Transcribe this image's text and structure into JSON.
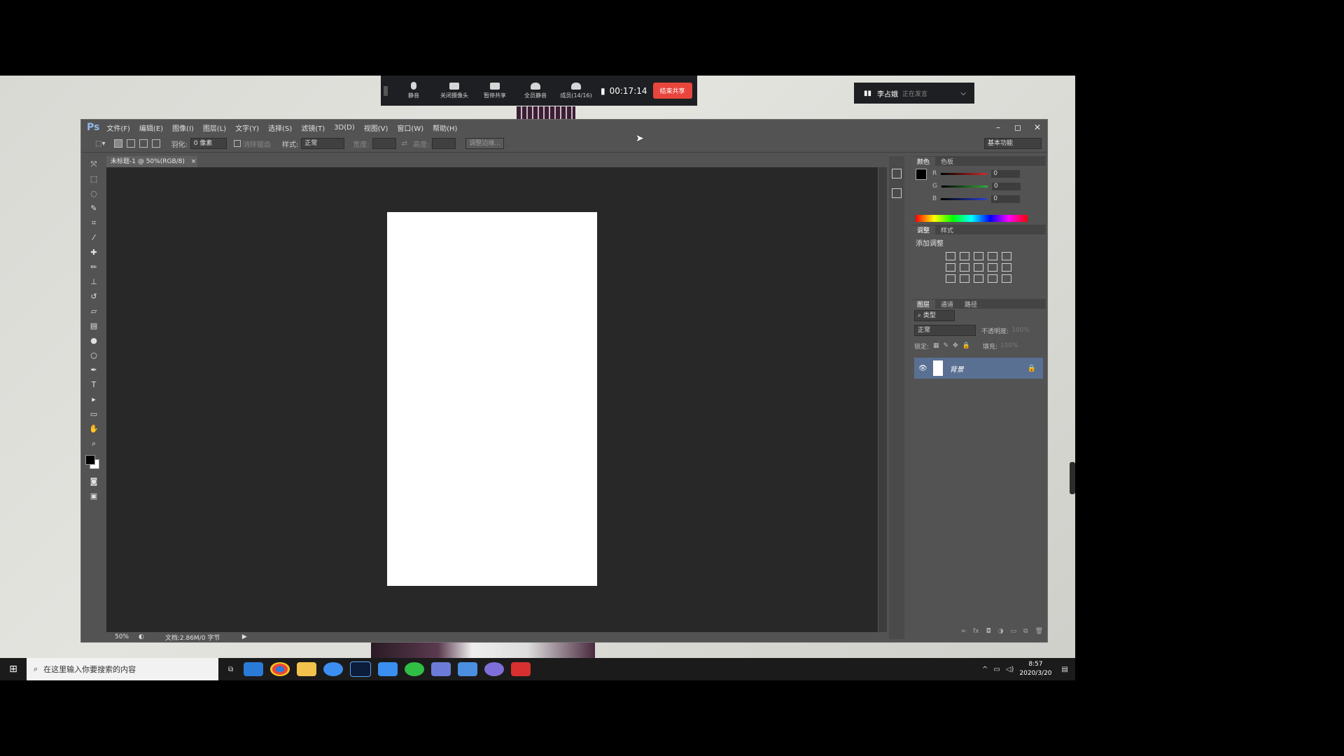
{
  "meeting": {
    "buttons": [
      {
        "label": "静音"
      },
      {
        "label": "关闭摄像头"
      },
      {
        "label": "暂停共享"
      },
      {
        "label": "全员静音"
      },
      {
        "label": "成员(14/16)"
      }
    ],
    "elapsed": "00:17:14",
    "end_label": "结束共享",
    "speaker_name": "李占娥",
    "speaker_status": "正在发言"
  },
  "ps": {
    "logo": "Ps",
    "menus": [
      "文件(F)",
      "编辑(E)",
      "图像(I)",
      "图层(L)",
      "文字(Y)",
      "选择(S)",
      "滤镜(T)",
      "3D(D)",
      "视图(V)",
      "窗口(W)",
      "帮助(H)"
    ],
    "options": {
      "feather_label": "羽化:",
      "feather_value": "0 像素",
      "antialias_label": "消除锯齿",
      "style_label": "样式:",
      "style_value": "正常",
      "width_label": "宽度:",
      "height_label": "高度:",
      "refine_edge": "调整边缘...",
      "workspace": "基本功能"
    },
    "doc_tab": "未标题-1 @ 50%(RGB/8)",
    "status": {
      "zoom": "50%",
      "doc_info": "文档:2.86M/0 字节"
    },
    "color_panel": {
      "tabs": [
        "颜色",
        "色板"
      ],
      "channels": [
        {
          "name": "R",
          "value": "0",
          "color": "#d22a2a"
        },
        {
          "name": "G",
          "value": "0",
          "color": "#2fae3a"
        },
        {
          "name": "B",
          "value": "0",
          "color": "#2a3fd2"
        }
      ]
    },
    "adjust_panel": {
      "tabs": [
        "调整",
        "样式"
      ],
      "title": "添加调整"
    },
    "layers_panel": {
      "tabs": [
        "图层",
        "通道",
        "路径"
      ],
      "filter_label": "类型",
      "blend_mode": "正常",
      "opacity_label": "不透明度:",
      "opacity_value": "100%",
      "lock_label": "锁定:",
      "fill_label": "填充:",
      "fill_value": "100%",
      "layer_name": "背景"
    }
  },
  "taskbar": {
    "search_placeholder": "在这里输入你要搜索的内容",
    "time": "8:57",
    "date": "2020/3/20"
  },
  "colors": {
    "ps_bg": "#535353",
    "canvas_bg": "#282828",
    "layer_selected": "#597092",
    "end_button": "#e8453c"
  }
}
